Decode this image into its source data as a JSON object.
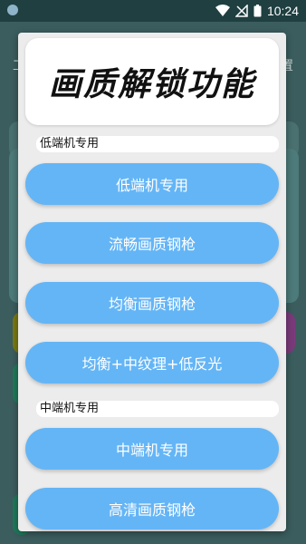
{
  "status_bar": {
    "time": "10:24"
  },
  "background": {
    "left_text": "工",
    "right_text": "置"
  },
  "dialog": {
    "banner_title": "画质解锁功能",
    "sections": [
      {
        "header": "低端机专用",
        "buttons": [
          "低端机专用",
          "流畅画质钢枪",
          "均衡画质钢枪",
          "均衡+中纹理+低反光"
        ]
      },
      {
        "header": "中端机专用",
        "buttons": [
          "中端机专用",
          "高清画质钢枪"
        ]
      }
    ]
  },
  "colors": {
    "button": "#64b5f6",
    "dialog_bg": "#ececec"
  }
}
